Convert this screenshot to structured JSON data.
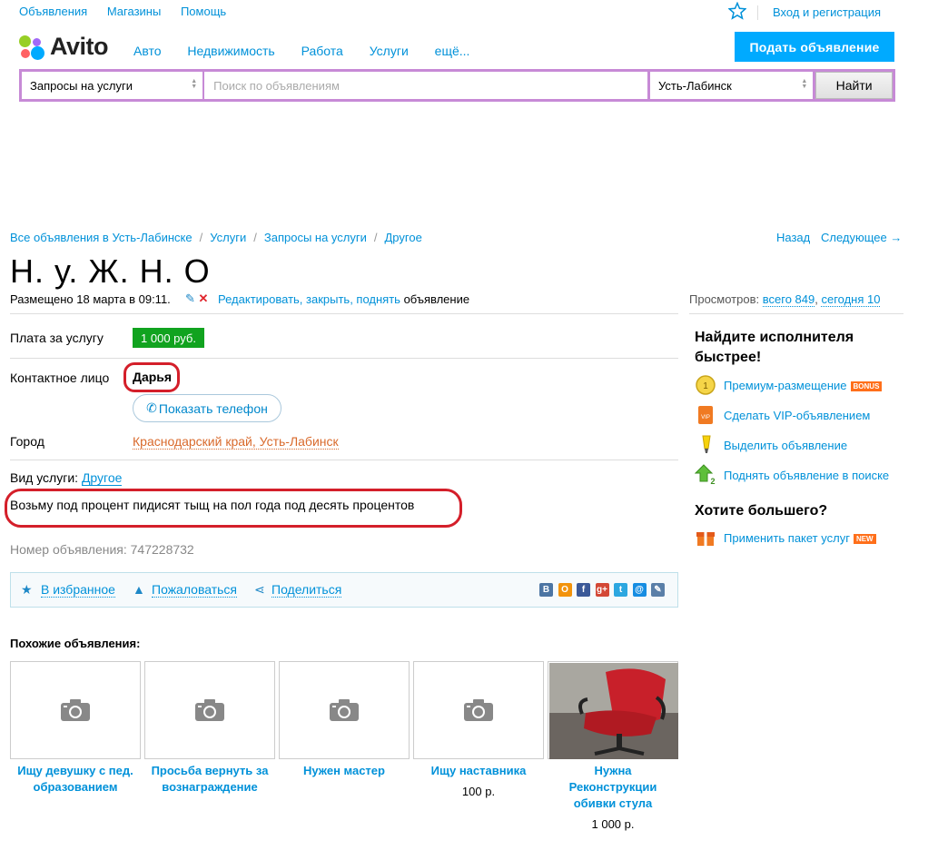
{
  "topnav": {
    "items": [
      "Объявления",
      "Магазины",
      "Помощь"
    ],
    "login": "Вход и регистрация"
  },
  "logo": {
    "text": "Avito"
  },
  "mainnav": {
    "items": [
      "Авто",
      "Недвижимость",
      "Работа",
      "Услуги",
      "ещё..."
    ]
  },
  "header": {
    "post_button": "Подать объявление"
  },
  "search": {
    "category": "Запросы на услуги",
    "placeholder": "Поиск по объявлениям",
    "city": "Усть-Лабинск",
    "submit": "Найти"
  },
  "breadcrumbs": [
    "Все объявления в Усть-Лабинске",
    "Услуги",
    "Запросы на услуги",
    "Другое"
  ],
  "nav": {
    "back": "Назад",
    "next": "Следующее →"
  },
  "item": {
    "title": "Н. у. Ж. Н. О",
    "posted": "Размещено 18 марта в 09:11.",
    "edit_links": "Редактировать, закрыть, поднять",
    "edit_suffix": "объявление",
    "views_label": "Просмотров:",
    "views_total": "всего 849",
    "views_today": "сегодня 10",
    "price_label": "Плата за услугу",
    "price": "1 000 руб.",
    "contact_label": "Контактное лицо",
    "contact_name": "Дарья",
    "phone_button": "Показать телефон",
    "city_label": "Город",
    "city": "Краснодарский край, Усть-Лабинск",
    "service_label": "Вид услуги:",
    "service_value": "Другое",
    "description": "Возьму под процент пидисят тыщ на пол года под десять процентов",
    "ad_number": "Номер объявления: 747228732"
  },
  "actions": {
    "favorite": "В избранное",
    "complain": "Пожаловаться",
    "share": "Поделиться"
  },
  "social": [
    {
      "icon": "vk-icon",
      "glyph": "В",
      "color": "#4c75a3"
    },
    {
      "icon": "odnoklassniki-icon",
      "glyph": "О",
      "color": "#f2930c"
    },
    {
      "icon": "facebook-icon",
      "glyph": "f",
      "color": "#3b5998"
    },
    {
      "icon": "google-plus-icon",
      "glyph": "g+",
      "color": "#d34836"
    },
    {
      "icon": "twitter-icon",
      "glyph": "t",
      "color": "#2ca7e0"
    },
    {
      "icon": "mail-icon",
      "glyph": "@",
      "color": "#168de2"
    },
    {
      "icon": "livejournal-icon",
      "glyph": "✎",
      "color": "#5a7fa8"
    }
  ],
  "similar": {
    "heading": "Похожие объявления:",
    "items": [
      {
        "title_l1": "Ищу девушку с пед.",
        "title_l2": "образованием",
        "title_l3": "",
        "price": ""
      },
      {
        "title_l1": "Просьба вернуть за",
        "title_l2": "вознаграждение",
        "title_l3": "",
        "price": ""
      },
      {
        "title_l1": "Нужен мастер",
        "title_l2": "",
        "title_l3": "",
        "price": ""
      },
      {
        "title_l1": "Ищу наставника",
        "title_l2": "",
        "title_l3": "",
        "price": "100 р."
      },
      {
        "title_l1": "Нужна",
        "title_l2": "Реконструкции",
        "title_l3": "обивки стула",
        "price": "1 000 р."
      }
    ]
  },
  "sidebar": {
    "heading1_l1": "Найдите исполнителя",
    "heading1_l2": "быстрее!",
    "premium": "Премиум-размещение",
    "premium_badge": "BONUS",
    "vip": "Сделать VIP-объявлением",
    "highlight": "Выделить объявление",
    "raise": "Поднять объявление в поиске",
    "heading2": "Хотите большего?",
    "package": "Применить пакет услуг",
    "package_badge": "NEW"
  },
  "colors": {
    "accent": "#0091d9",
    "button": "#00aaff",
    "price_bg": "#11a31f",
    "annotation": "#d41f2a",
    "search_border": "#c78ad6"
  }
}
